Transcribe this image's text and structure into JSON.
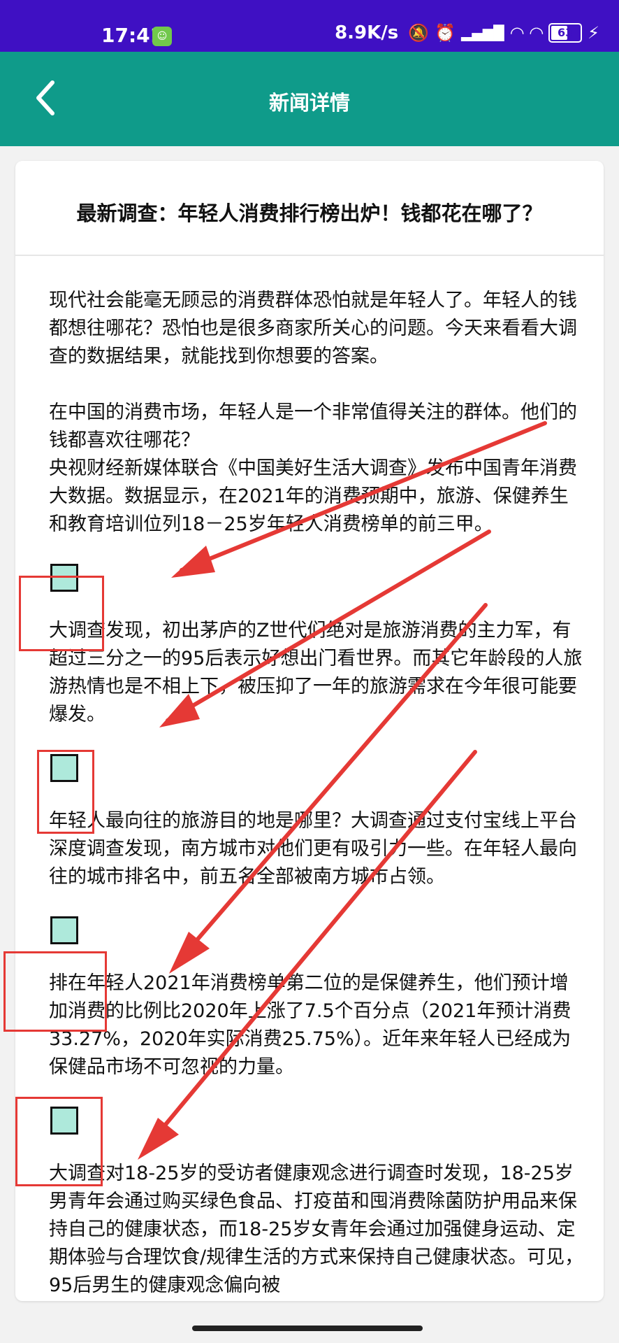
{
  "status_bar": {
    "time": "17:41",
    "app_icon": "cat-icon",
    "speed": "8.9K/s",
    "battery_level": "63",
    "battery_fraction": 0.63,
    "icons": [
      "mute-bell-icon",
      "alarm-icon",
      "hd-signal-icon",
      "wifi-calling-icon",
      "wifi-icon",
      "battery-icon",
      "charging-icon"
    ]
  },
  "app_bar": {
    "title": "新闻详情",
    "back_icon": "chevron-left-icon"
  },
  "article": {
    "title": "最新调查：年轻人消费排行榜出炉！钱都花在哪了？",
    "paragraphs": [
      "现代社会能毫无顾忌的消费群体恐怕就是年轻人了。年轻人的钱都想往哪花？恐怕也是很多商家所关心的问题。今天来看看大调查的数据结果，就能找到你想要的答案。",
      "在中国的消费市场，年轻人是一个非常值得关注的群体。他们的钱都喜欢往哪花？",
      "央视财经新媒体联合《中国美好生活大调查》发布中国青年消费大数据。数据显示，在2021年的消费预期中，旅游、保健养生和教育培训位列18－25岁年轻人消费榜单的前三甲。",
      "大调查发现，初出茅庐的Z世代们绝对是旅游消费的主力军，有超过三分之一的95后表示好想出门看世界。而其它年龄段的人旅游热情也是不相上下，被压抑了一年的旅游需求在今年很可能要爆发。",
      "年轻人最向往的旅游目的地是哪里？大调查通过支付宝线上平台深度调查发现，南方城市对他们更有吸引力一些。在年轻人最向往的城市排名中，前五名全部被南方城市占领。",
      "排在年轻人2021年消费榜单第二位的是保健养生，他们预计增加消费的比例比2020年上涨了7.5个百分点（2021年预计消费33.27%，2020年实际消费25.75%）。近年来年轻人已经成为保健品市场不可忽视的力量。",
      "大调查对18-25岁的受访者健康观念进行调查时发现，18-25岁男青年会通过购买绿色食品、打疫苗和囤消费除菌防护用品来保持自己的健康状态，而18-25岁女青年会通过加强健身运动、定期体验与合理饮食/规律生活的方式来保持自己健康状态。可见，95后男生的健康观念偏向被"
    ],
    "image_placeholder_icon": "broken-image-icon"
  },
  "annotation_color": "#e53935",
  "theme": {
    "status_bar": "#3f10c3",
    "app_bar": "#0f9b8a"
  }
}
